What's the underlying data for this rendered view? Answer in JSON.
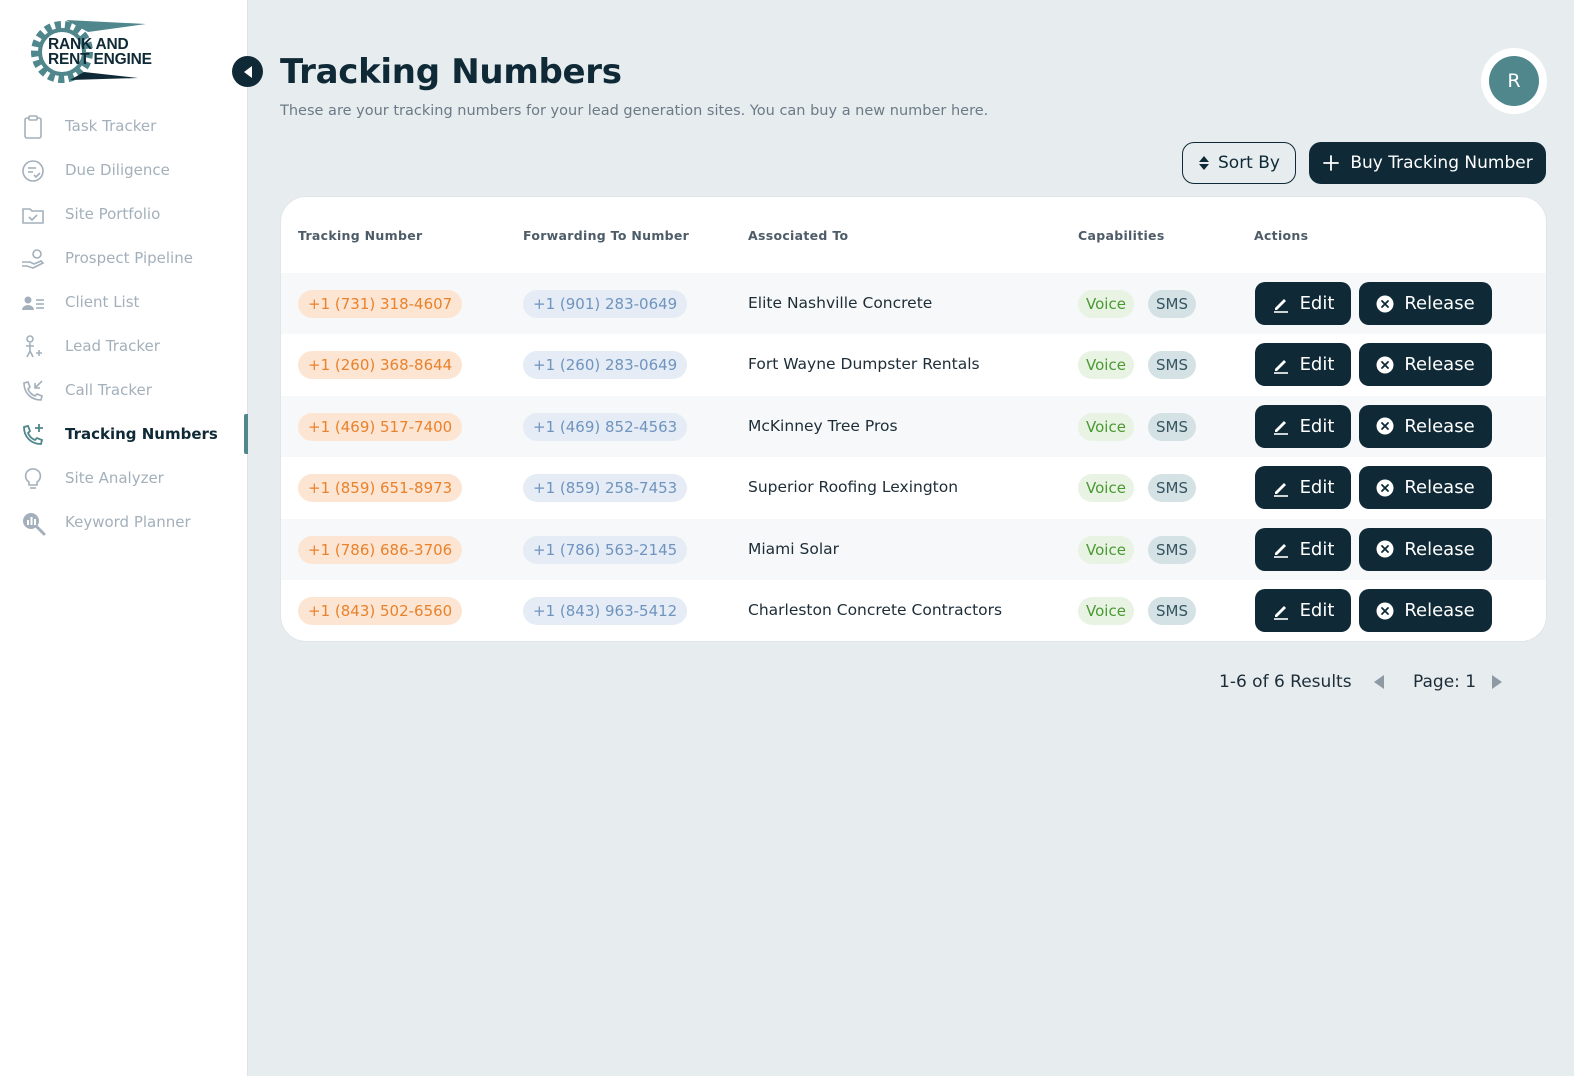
{
  "brand": {
    "name_line1": "RANK AND",
    "name_line2": "RENT ENGINE"
  },
  "sidebar": {
    "items": [
      {
        "label": "Task Tracker",
        "icon": "clipboard-icon"
      },
      {
        "label": "Due Diligence",
        "icon": "checklist-icon"
      },
      {
        "label": "Site Portfolio",
        "icon": "folder-check-icon"
      },
      {
        "label": "Prospect Pipeline",
        "icon": "hand-coins-icon"
      },
      {
        "label": "Client List",
        "icon": "contact-list-icon"
      },
      {
        "label": "Lead Tracker",
        "icon": "person-plus-icon"
      },
      {
        "label": "Call Tracker",
        "icon": "incoming-call-icon"
      },
      {
        "label": "Tracking Numbers",
        "icon": "phone-plus-icon",
        "active": true
      },
      {
        "label": "Site Analyzer",
        "icon": "lightbulb-icon"
      },
      {
        "label": "Keyword Planner",
        "icon": "search-chart-icon"
      }
    ]
  },
  "header": {
    "title": "Tracking Numbers",
    "subtitle": "These are your tracking numbers for your lead generation sites. You can buy a new number here.",
    "avatar_initial": "R"
  },
  "toolbar": {
    "sort_label": "Sort By",
    "buy_label": "Buy Tracking Number"
  },
  "table": {
    "columns": [
      "Tracking Number",
      "Forwarding To Number",
      "Associated To",
      "Capabilities",
      "Actions"
    ],
    "rows": [
      {
        "tracking": "+1 (731) 318-4607",
        "forwarding": "+1 (901) 283-0649",
        "associated": "Elite Nashville Concrete",
        "cap1": "Voice",
        "cap2": "SMS"
      },
      {
        "tracking": "+1 (260) 368-8644",
        "forwarding": "+1 (260) 283-0649",
        "associated": "Fort Wayne Dumpster Rentals",
        "cap1": "Voice",
        "cap2": "SMS"
      },
      {
        "tracking": "+1 (469) 517-7400",
        "forwarding": "+1 (469) 852-4563",
        "associated": "McKinney Tree Pros",
        "cap1": "Voice",
        "cap2": "SMS"
      },
      {
        "tracking": "+1 (859) 651-8973",
        "forwarding": "+1 (859) 258-7453",
        "associated": "Superior Roofing Lexington",
        "cap1": "Voice",
        "cap2": "SMS"
      },
      {
        "tracking": "+1 (786) 686-3706",
        "forwarding": "+1 (786) 563-2145",
        "associated": "Miami Solar",
        "cap1": "Voice",
        "cap2": "SMS"
      },
      {
        "tracking": "+1 (843) 502-6560",
        "forwarding": "+1 (843) 963-5412",
        "associated": "Charleston Concrete Contractors",
        "cap1": "Voice",
        "cap2": "SMS"
      }
    ],
    "edit_label": "Edit",
    "release_label": "Release"
  },
  "pagination": {
    "results": "1-6 of 6 Results",
    "page": "Page: 1"
  },
  "colors": {
    "primary": "#0f2a36",
    "accent": "#4f878d",
    "tracking_pill": "#e8822c",
    "forwarding_pill": "#6f94bf",
    "voice": "#4b9a31"
  }
}
